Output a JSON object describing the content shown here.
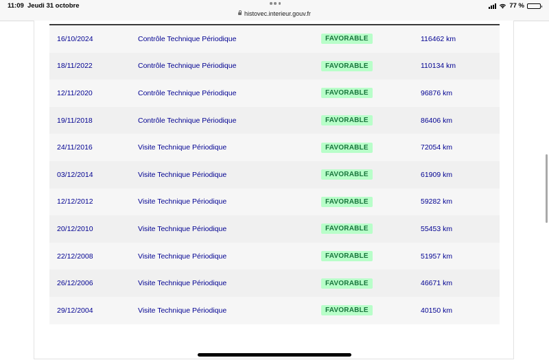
{
  "status_bar": {
    "time": "11:09",
    "date": "Jeudi 31 octobre",
    "url": "histovec.interieur.gouv.fr",
    "battery": "77 %",
    "battery_level": 0.77
  },
  "table": {
    "rows": [
      {
        "date": "16/10/2024",
        "type": "Contrôle Technique Périodique",
        "result": "FAVORABLE",
        "km": "116462 km"
      },
      {
        "date": "18/11/2022",
        "type": "Contrôle Technique Périodique",
        "result": "FAVORABLE",
        "km": "110134 km"
      },
      {
        "date": "12/11/2020",
        "type": "Contrôle Technique Périodique",
        "result": "FAVORABLE",
        "km": "96876 km"
      },
      {
        "date": "19/11/2018",
        "type": "Contrôle Technique Périodique",
        "result": "FAVORABLE",
        "km": "86406 km"
      },
      {
        "date": "24/11/2016",
        "type": "Visite Technique Périodique",
        "result": "FAVORABLE",
        "km": "72054 km"
      },
      {
        "date": "03/12/2014",
        "type": "Visite Technique Périodique",
        "result": "FAVORABLE",
        "km": "61909 km"
      },
      {
        "date": "12/12/2012",
        "type": "Visite Technique Périodique",
        "result": "FAVORABLE",
        "km": "59282 km"
      },
      {
        "date": "20/12/2010",
        "type": "Visite Technique Périodique",
        "result": "FAVORABLE",
        "km": "55453 km"
      },
      {
        "date": "22/12/2008",
        "type": "Visite Technique Périodique",
        "result": "FAVORABLE",
        "km": "51957 km"
      },
      {
        "date": "26/12/2006",
        "type": "Visite Technique Périodique",
        "result": "FAVORABLE",
        "km": "46671 km"
      },
      {
        "date": "29/12/2004",
        "type": "Visite Technique Périodique",
        "result": "FAVORABLE",
        "km": "40150 km"
      }
    ]
  },
  "colors": {
    "text_blue": "#000091",
    "badge_bg": "#b8fec9",
    "badge_text": "#18753c"
  }
}
